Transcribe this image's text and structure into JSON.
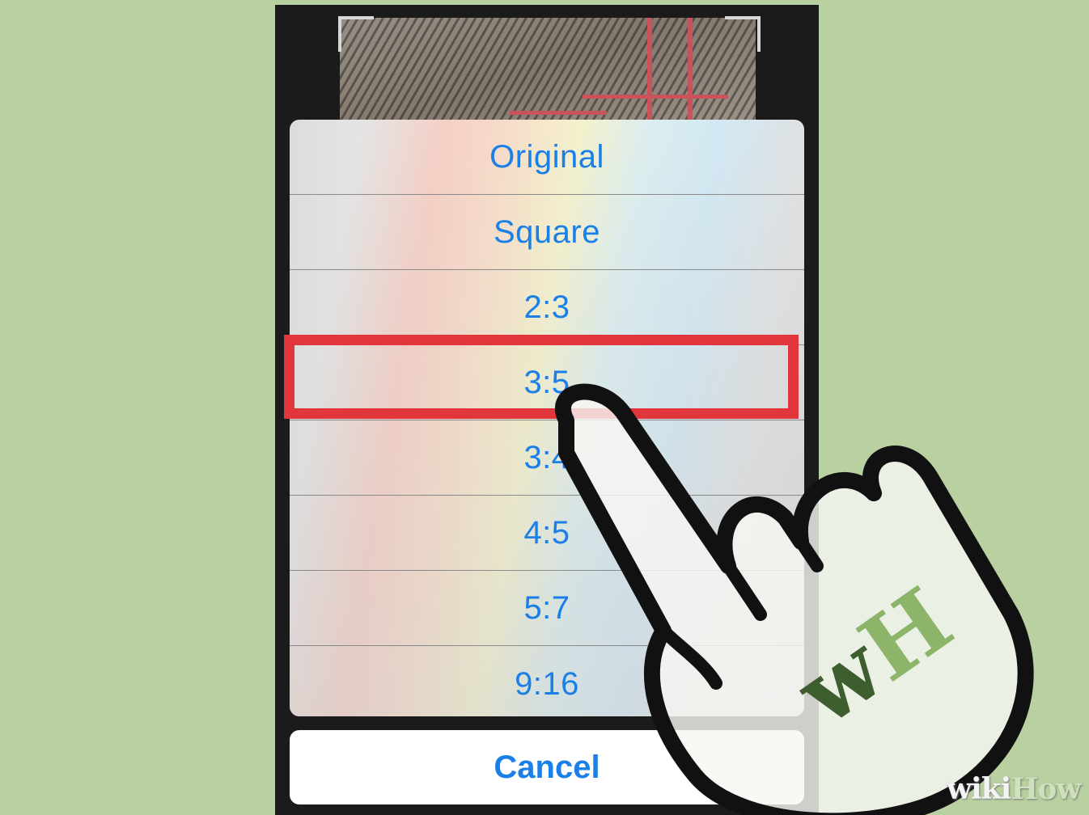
{
  "colors": {
    "background": "#b9d0a0",
    "accent_text": "#1a7fe6",
    "highlight": "#e2363d"
  },
  "crop_sheet": {
    "options": [
      {
        "label": "Original",
        "highlighted": false
      },
      {
        "label": "Square",
        "highlighted": false
      },
      {
        "label": "2:3",
        "highlighted": false
      },
      {
        "label": "3:5",
        "highlighted": true
      },
      {
        "label": "3:4",
        "highlighted": false
      },
      {
        "label": "4:5",
        "highlighted": false
      },
      {
        "label": "5:7",
        "highlighted": false
      },
      {
        "label": "9:16",
        "highlighted": false
      }
    ],
    "cancel_label": "Cancel"
  },
  "overlay": {
    "hand_icon": "pointing-hand-icon",
    "logo_letters": "wH",
    "watermark_wiki": "wiki",
    "watermark_how": "How"
  }
}
